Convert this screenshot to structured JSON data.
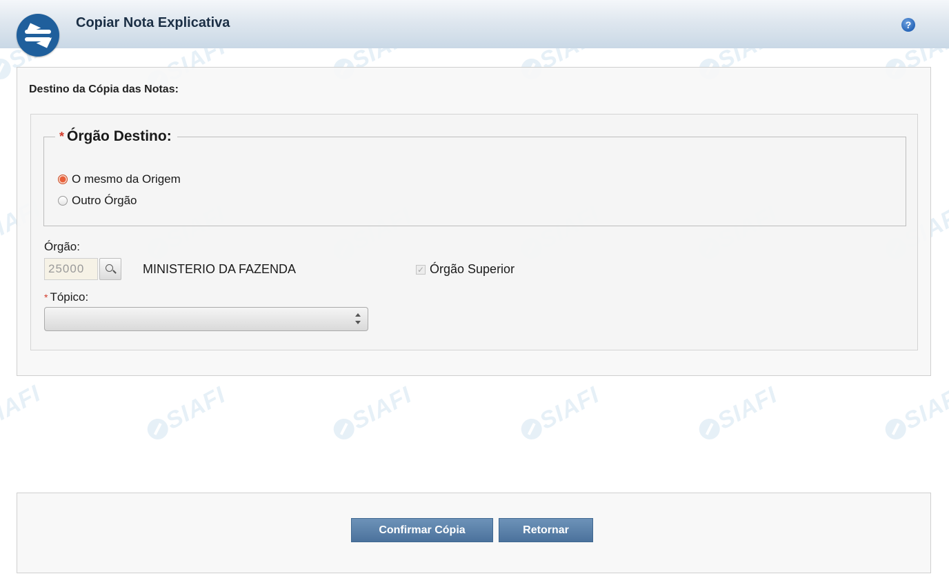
{
  "header": {
    "title": "Copiar Nota Explicativa",
    "help_icon": "help-icon"
  },
  "watermark": {
    "text": "SIAFI"
  },
  "form": {
    "section_title": "Destino da Cópia das Notas:",
    "orgao_destino": {
      "legend": "Órgão Destino:",
      "required_mark": "*",
      "options": [
        {
          "label": "O mesmo da Origem",
          "checked": true
        },
        {
          "label": "Outro Órgão",
          "checked": false
        }
      ]
    },
    "orgao": {
      "label": "Órgão:",
      "code": "25000",
      "name": "MINISTERIO DA FAZENDA",
      "superior_label": "Órgão Superior",
      "superior_checked": true,
      "lookup_icon": "magnifier-icon"
    },
    "topico": {
      "label": "Tópico:",
      "required_mark": "*",
      "selected": ""
    }
  },
  "actions": {
    "confirm_label": "Confirmar Cópia",
    "return_label": "Retornar"
  },
  "colors": {
    "header_blue": "#1f5f9c",
    "button_blue": "#5a80a9",
    "required_red": "#d23a2a"
  }
}
